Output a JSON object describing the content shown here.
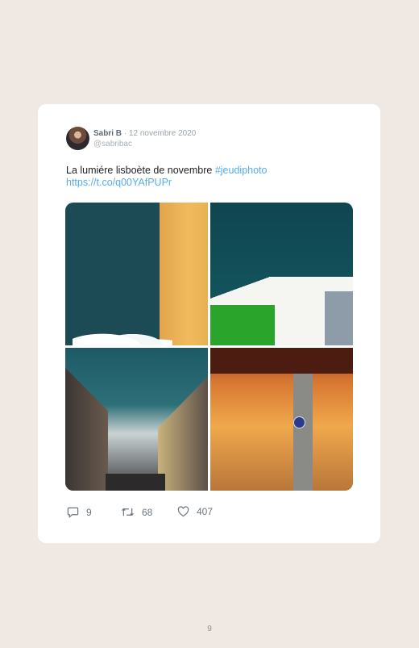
{
  "tweet": {
    "author_name": "Sabri B",
    "separator": "·",
    "date": "12 novembre 2020",
    "handle": "@sabribac",
    "text": "La lumiére lisboète de novembre ",
    "hashtag": "#jeudiphoto",
    "link": "https://t.co/q00YAfPUPr",
    "photos": [
      {
        "subject": "yellow-wall-blue-sky"
      },
      {
        "subject": "white-building-green-wall"
      },
      {
        "subject": "lisbon-street"
      },
      {
        "subject": "orange-underpass-pillar"
      }
    ],
    "stats": {
      "replies": "9",
      "retweets": "68",
      "likes": "407"
    },
    "icons": {
      "reply": "reply-icon",
      "retweet": "retweet-icon",
      "like": "heart-icon"
    }
  },
  "page_number": "9",
  "colors": {
    "background": "#efe8e3",
    "card": "#ffffff",
    "link": "#55acee"
  }
}
